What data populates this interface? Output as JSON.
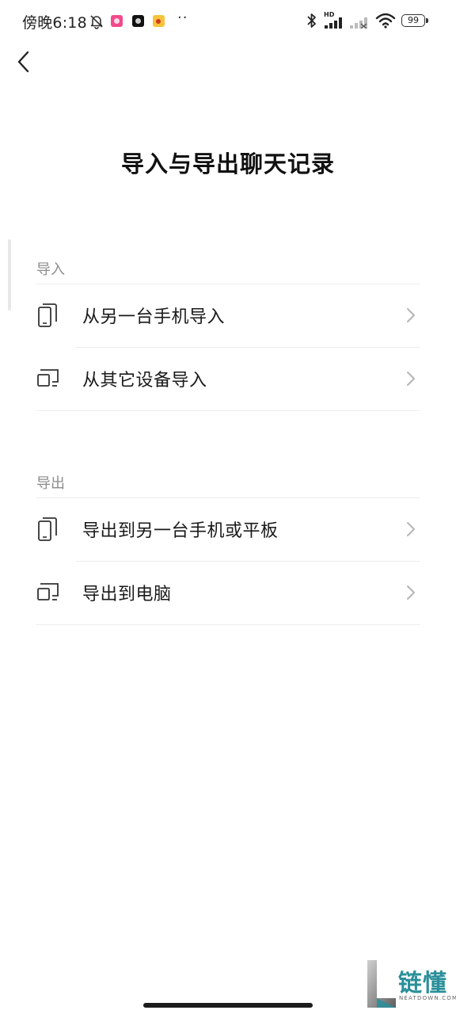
{
  "status_bar": {
    "time": "傍晚6:18",
    "dots": "··",
    "network_hd": "HD",
    "battery": "99"
  },
  "header": {
    "title": "导入与导出聊天记录"
  },
  "sections": {
    "import": {
      "header": "导入",
      "items": [
        {
          "label": "从另一台手机导入",
          "icon": "phone-icon"
        },
        {
          "label": "从其它设备导入",
          "icon": "monitor-icon"
        }
      ]
    },
    "export": {
      "header": "导出",
      "items": [
        {
          "label": "导出到另一台手机或平板",
          "icon": "phone-icon"
        },
        {
          "label": "导出到电脑",
          "icon": "monitor-icon"
        }
      ]
    }
  },
  "watermark": {
    "text": "链懂",
    "sub": "NEATDOWN.COM"
  },
  "colors": {
    "accent_watermark": "#2a8f9a",
    "section_header": "#8c8c8c",
    "divider": "#ececec"
  }
}
